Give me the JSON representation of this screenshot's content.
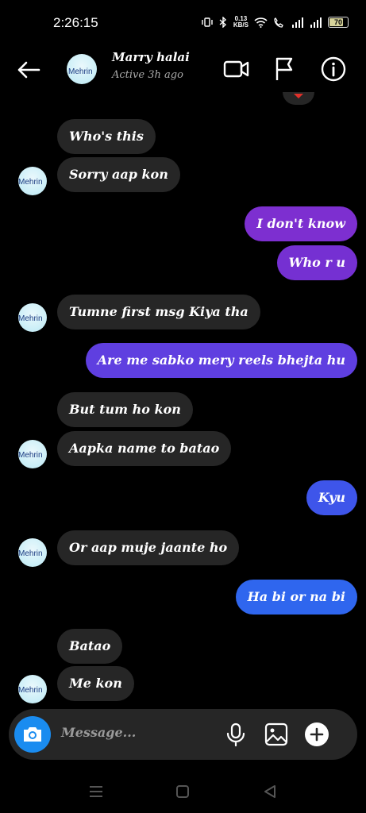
{
  "status_bar": {
    "time": "2:26:15",
    "speed_value": "0.13",
    "speed_unit": "KB/S",
    "battery": "70"
  },
  "header": {
    "avatar_text": "Mehrin",
    "name": "Marry halai",
    "status": "Active 3h ago",
    "icons": [
      "back-arrow-icon",
      "video-call-icon",
      "flag-icon",
      "info-icon"
    ]
  },
  "messages": [
    {
      "side": "in",
      "text": "Who's this"
    },
    {
      "side": "in",
      "text": "Sorry aap kon"
    },
    {
      "side": "out",
      "text": "I don't know",
      "color": "#7d2fd0"
    },
    {
      "side": "out",
      "text": "Who r u",
      "color": "#7530d2"
    },
    {
      "side": "in",
      "text": "Tumne first msg Kiya tha"
    },
    {
      "side": "out",
      "text": "Are me sabko mery reels bhejta hu",
      "color": "#5f3fe0"
    },
    {
      "side": "in",
      "text": "But tum ho kon"
    },
    {
      "side": "in",
      "text": "Aapka name to batao"
    },
    {
      "side": "out",
      "text": "Kyu",
      "color": "#3e55ea"
    },
    {
      "side": "in",
      "text": "Or aap muje jaante ho"
    },
    {
      "side": "out",
      "text": "Ha bi or na bi",
      "color": "#2f66ee"
    },
    {
      "side": "in",
      "text": "Batao"
    },
    {
      "side": "in",
      "text": "Me kon"
    }
  ],
  "avatar_label": "Mehrin",
  "composer": {
    "placeholder": "Message...",
    "icons": [
      "camera-icon",
      "microphone-icon",
      "gallery-icon",
      "plus-icon"
    ]
  },
  "colors": {
    "incoming_bubble": "#262626",
    "camera_button": "#1a8cf0",
    "background": "#000000"
  }
}
